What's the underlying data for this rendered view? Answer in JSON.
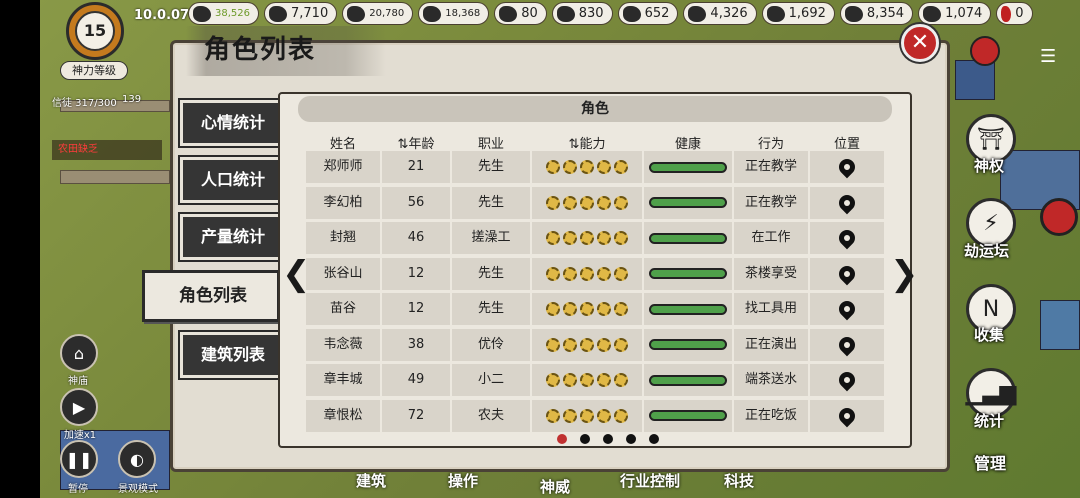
{
  "status": {
    "level": "15",
    "level_label": "神力等级",
    "clock": "10.0.07",
    "faith": "信徒 317/300",
    "faith_count": "139",
    "alert": "农田缺乏"
  },
  "resources": [
    {
      "icon": "leaf-icon",
      "value": "38,526",
      "style": "green"
    },
    {
      "icon": "coin-pile-icon",
      "value": "7,710"
    },
    {
      "icon": "ore-icon",
      "value": "20,780",
      "style": "small"
    },
    {
      "icon": "stone-icon",
      "value": "18,368",
      "style": "small"
    },
    {
      "icon": "cloud-icon",
      "value": "80"
    },
    {
      "icon": "pig-icon",
      "value": "830"
    },
    {
      "icon": "pickaxe-icon",
      "value": "652"
    },
    {
      "icon": "grain-bag-icon",
      "value": "4,326"
    },
    {
      "icon": "feather-icon",
      "value": "1,692"
    },
    {
      "icon": "boat-icon",
      "value": "8,354"
    },
    {
      "icon": "chest-icon",
      "value": "1,074"
    },
    {
      "icon": "blood-drop-icon",
      "value": "0"
    }
  ],
  "panel": {
    "title": "角色列表",
    "section": "角色"
  },
  "tabs": [
    {
      "label": "心情统计",
      "active": false
    },
    {
      "label": "人口统计",
      "active": false
    },
    {
      "label": "产量统计",
      "active": false
    },
    {
      "label": "角色列表",
      "active": true
    },
    {
      "label": "建筑列表",
      "active": false
    }
  ],
  "headers": {
    "name": "姓名",
    "age": "年龄",
    "job": "职业",
    "ability": "能力",
    "health": "健康",
    "action": "行为",
    "location": "位置"
  },
  "rows": [
    {
      "name": "郑师师",
      "age": "21",
      "job": "先生",
      "stars": 5,
      "health": 1,
      "action": "正在教学"
    },
    {
      "name": "李幻柏",
      "age": "56",
      "job": "先生",
      "stars": 5,
      "health": 1,
      "action": "正在教学"
    },
    {
      "name": "封翘",
      "age": "46",
      "job": "搓澡工",
      "stars": 5,
      "health": 1,
      "action": "在工作"
    },
    {
      "name": "张谷山",
      "age": "12",
      "job": "先生",
      "stars": 5,
      "health": 1,
      "action": "茶楼享受"
    },
    {
      "name": "苗谷",
      "age": "12",
      "job": "先生",
      "stars": 5,
      "health": 1,
      "action": "找工具用"
    },
    {
      "name": "韦念薇",
      "age": "38",
      "job": "优伶",
      "stars": 5,
      "health": 1,
      "action": "正在演出"
    },
    {
      "name": "章丰城",
      "age": "49",
      "job": "小二",
      "stars": 5,
      "health": 1,
      "action": "端茶送水"
    },
    {
      "name": "章恨松",
      "age": "72",
      "job": "农夫",
      "stars": 5,
      "health": 1,
      "action": "正在吃饭"
    }
  ],
  "pagination": {
    "pages": 5,
    "current": 1
  },
  "left_buttons": {
    "temple": "神庙",
    "speed": "加速x1",
    "pause": "暂停",
    "view": "景观模式"
  },
  "right_buttons": {
    "divine": "神权",
    "tribulation": "劫运坛",
    "collect": "收集",
    "stats": "统计",
    "manage": "管理"
  },
  "bottom_tabs": [
    "建筑",
    "操作",
    "神威",
    "行业控制",
    "科技"
  ],
  "colors": {
    "health_bar": "#4fa04a",
    "close": "#c02828",
    "accent_active_dot": "#c03030"
  }
}
